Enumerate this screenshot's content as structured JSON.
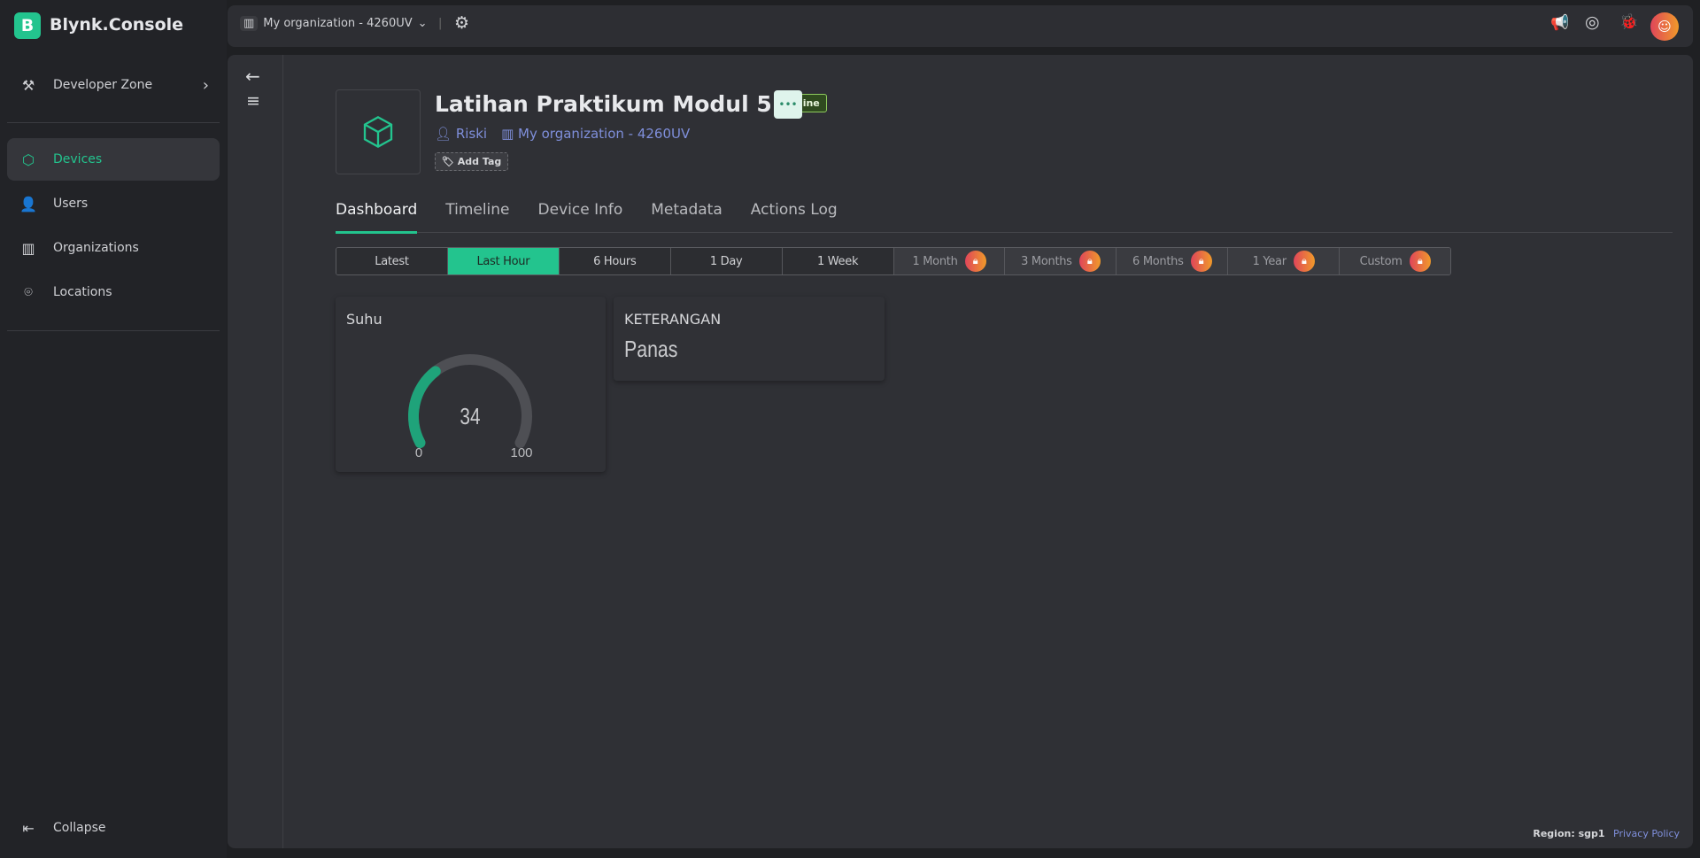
{
  "brand": {
    "logo_letter": "B",
    "name": "Blynk.Console"
  },
  "sidebar": {
    "developer_zone": "Developer Zone",
    "items": [
      {
        "label": "Devices",
        "icon": "cube-icon",
        "active": true
      },
      {
        "label": "Users",
        "icon": "users-icon"
      },
      {
        "label": "Organizations",
        "icon": "building-icon"
      },
      {
        "label": "Locations",
        "icon": "pin-icon"
      }
    ],
    "collapse": "Collapse"
  },
  "topbar": {
    "org": "My organization - 4260UV"
  },
  "device": {
    "name": "Latihan Praktikum Modul 5",
    "status": "Online",
    "owner": "Riski",
    "org": "My organization - 4260UV",
    "add_tag": "Add Tag"
  },
  "tabs": [
    "Dashboard",
    "Timeline",
    "Device Info",
    "Metadata",
    "Actions Log"
  ],
  "active_tab": "Dashboard",
  "ranges": [
    {
      "label": "Latest"
    },
    {
      "label": "Last Hour",
      "active": true
    },
    {
      "label": "6 Hours"
    },
    {
      "label": "1 Day"
    },
    {
      "label": "1 Week"
    },
    {
      "label": "1 Month",
      "locked": true
    },
    {
      "label": "3 Months",
      "locked": true
    },
    {
      "label": "6 Months",
      "locked": true
    },
    {
      "label": "1 Year",
      "locked": true
    },
    {
      "label": "Custom",
      "locked": true
    }
  ],
  "widgets": {
    "gauge": {
      "title": "Suhu",
      "value": 34,
      "min": 0,
      "max": 100,
      "min_label": "0",
      "max_label": "100",
      "value_label": "34",
      "color": "#1fa37a"
    },
    "label": {
      "title": "KETERANGAN",
      "value": "Panas"
    }
  },
  "footer": {
    "region": "Region: sgp1",
    "privacy": "Privacy Policy"
  },
  "colors": {
    "accent": "#23c48e",
    "link": "#7f8fdb"
  }
}
